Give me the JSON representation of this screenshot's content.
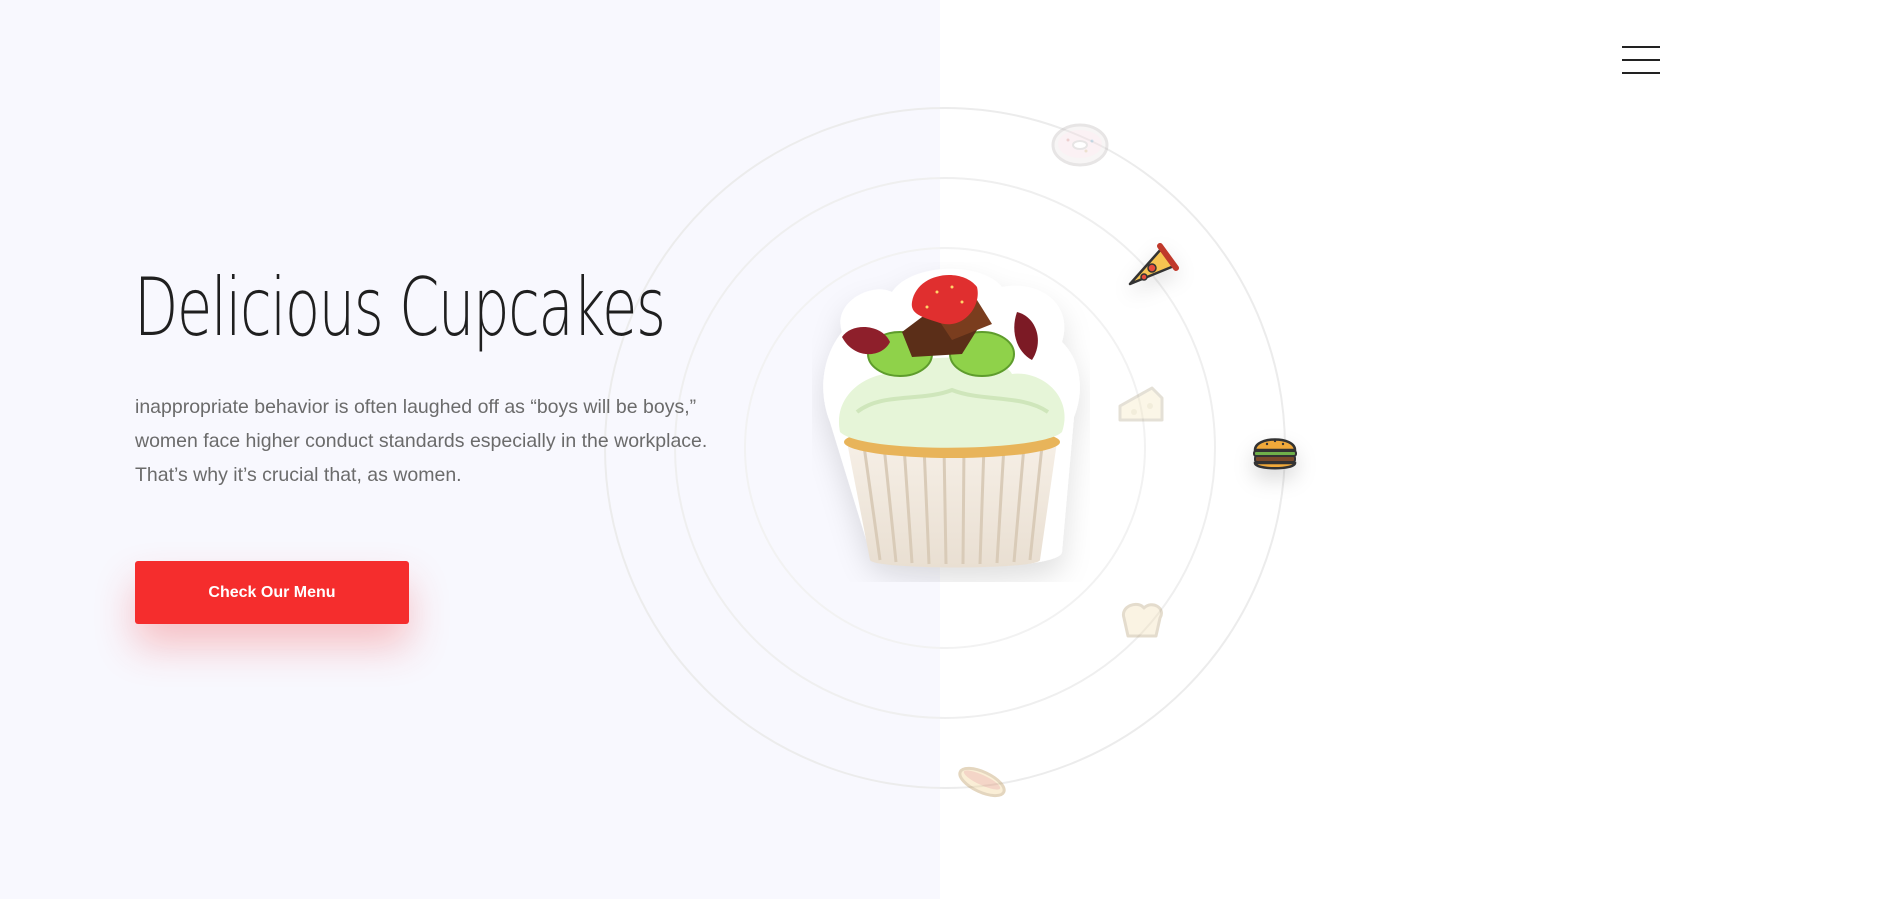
{
  "nav": {
    "menu_icon": "hamburger-menu-icon"
  },
  "hero": {
    "title": "Delicious Cupcakes",
    "description": "inappropriate behavior is often laughed off as “boys will be boys,” women face higher conduct standards especially in the workplace. That’s why it’s crucial that, as women.",
    "cta_label": "Check Our Menu"
  },
  "colors": {
    "left_background": "#f8f8fe",
    "accent": "#f52d2d",
    "title": "#1f1f1f",
    "body_text": "#6b6b6b"
  },
  "orbit_icons": [
    "donut-icon",
    "pizza-icon",
    "cheese-icon",
    "burger-icon",
    "bread-icon",
    "hotdog-icon"
  ],
  "hero_image": "cupcake-image"
}
